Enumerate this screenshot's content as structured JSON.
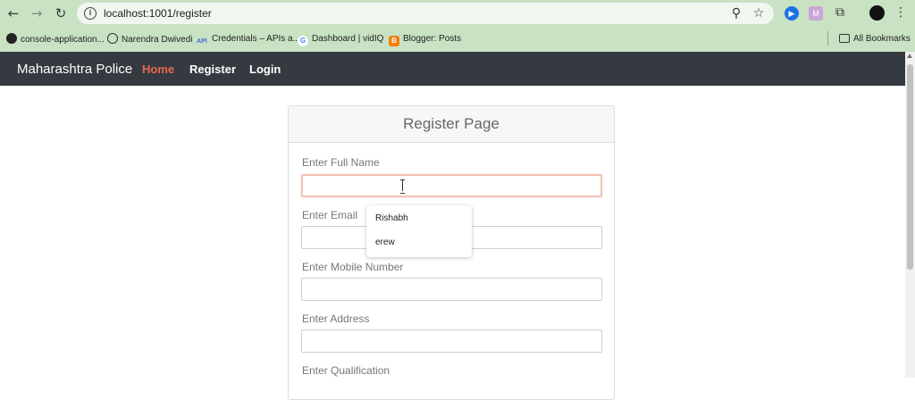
{
  "browser": {
    "url": "localhost:1001/register",
    "bookmarks": [
      {
        "label": "console-application...",
        "icon": "github-icon"
      },
      {
        "label": "Narendra Dwivedi",
        "icon": "person-icon"
      },
      {
        "label": "Credentials – APIs a...",
        "icon": "api-icon"
      },
      {
        "label": "Dashboard | vidIQ",
        "icon": "google-icon"
      },
      {
        "label": "Blogger: Posts",
        "icon": "blogger-icon"
      }
    ],
    "all_bookmarks": "All Bookmarks"
  },
  "navbar": {
    "brand": "Maharashtra Police",
    "links": [
      "Home",
      "Register",
      "Login"
    ],
    "active_color": "#e8674c",
    "background": "#343a40"
  },
  "form": {
    "title": "Register Page",
    "fields": [
      {
        "label": "Enter Full Name",
        "value": ""
      },
      {
        "label": "Enter Email",
        "value": ""
      },
      {
        "label": "Enter Mobile Number",
        "value": ""
      },
      {
        "label": "Enter Address",
        "value": ""
      },
      {
        "label": "Enter Qualification",
        "value": ""
      }
    ]
  },
  "autofill": {
    "options": [
      "Rishabh",
      "erew"
    ]
  }
}
